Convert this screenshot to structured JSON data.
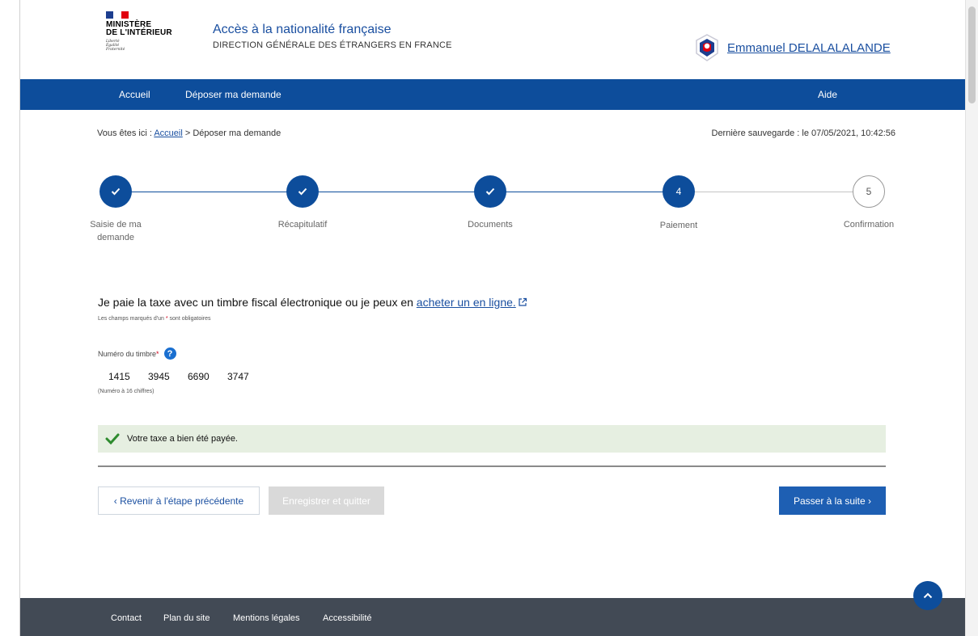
{
  "header": {
    "logo": {
      "name": "Ministère de l'Intérieur",
      "title_line1": "MINISTÈRE",
      "title_line2": "DE L'INTÉRIEUR",
      "motto": [
        "Liberté",
        "Égalité",
        "Fraternité"
      ]
    },
    "site_title": "Accès à la nationalité française",
    "site_subtitle": "DIRECTION GÉNÉRALE DES ÉTRANGERS EN FRANCE",
    "user_icon": "shield-user-icon",
    "user_name": "Emmanuel DELALALALANDE"
  },
  "nav": {
    "items": [
      {
        "label": "Accueil"
      },
      {
        "label": "Déposer ma demande"
      }
    ],
    "help": "Aide"
  },
  "breadcrumb": {
    "prefix": "Vous êtes ici :",
    "home": "Accueil",
    "separator": ">",
    "current": "Déposer ma demande"
  },
  "last_save": "Dernière sauvegarde : le 07/05/2021, 10:42:56",
  "stepper": {
    "steps": [
      {
        "number": "1",
        "label": "Saisie de ma demande",
        "state": "done"
      },
      {
        "number": "2",
        "label": "Récapitulatif",
        "state": "done"
      },
      {
        "number": "3",
        "label": "Documents",
        "state": "done"
      },
      {
        "number": "4",
        "label": "Paiement",
        "state": "active"
      },
      {
        "number": "5",
        "label": "Confirmation",
        "state": "todo"
      }
    ]
  },
  "form": {
    "title_text": "Je paie la taxe avec un timbre fiscal électronique ou je peux en",
    "title_link": "acheter un en ligne.",
    "required_note_before": "Les champs marqués d'un",
    "required_note_star": "*",
    "required_note_after": "sont obligatoires",
    "stamp_label": "Numéro du timbre",
    "stamp_required_star": "*",
    "stamp_parts": [
      "1415",
      "3945",
      "6690",
      "3747"
    ],
    "stamp_hint": "(Numéro à 16 chiffres)"
  },
  "alert": {
    "icon": "check-icon",
    "message": "Votre taxe a bien été payée."
  },
  "buttons": {
    "back": "‹ Revenir à l'étape précédente",
    "save_quit": "Enregistrer et quitter",
    "next": "Passer à la suite ›"
  },
  "footer": {
    "links": [
      "Contact",
      "Plan du site",
      "Mentions légales",
      "Accessibilité"
    ]
  },
  "colors": {
    "primary": "#0d4d9b",
    "link": "#1a4fa0",
    "footer": "#424a55",
    "success_bg": "#e6efe1",
    "success_icon": "#2e8b2e"
  }
}
